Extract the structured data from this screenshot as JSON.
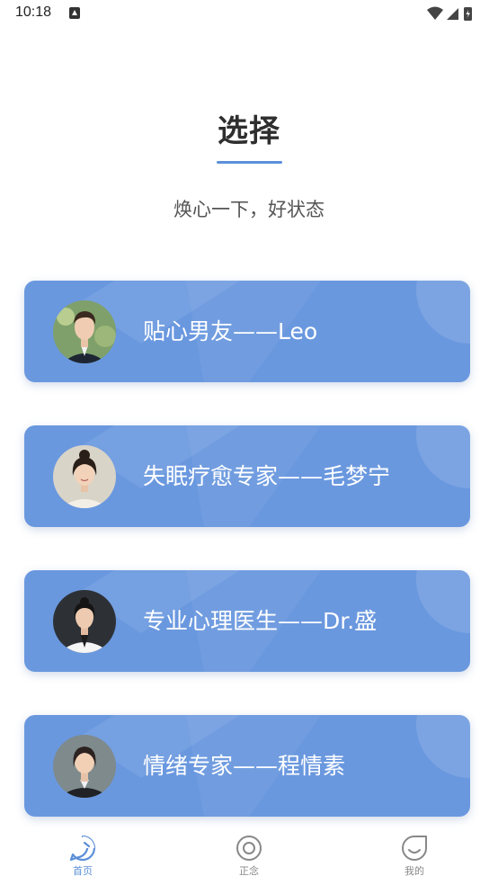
{
  "status_bar": {
    "time": "10:18"
  },
  "header": {
    "title": "选择",
    "subtitle": "焕心一下，好状态"
  },
  "cards": [
    {
      "label": "贴心男友——Leo"
    },
    {
      "label": "失眠疗愈专家——毛梦宁"
    },
    {
      "label": "专业心理医生——Dr.盛"
    },
    {
      "label": "情绪专家——程情素"
    }
  ],
  "tab_bar": {
    "items": [
      {
        "label": "首页",
        "icon": "chat-bubble-icon",
        "active": true
      },
      {
        "label": "正念",
        "icon": "circle-target-icon",
        "active": false
      },
      {
        "label": "我的",
        "icon": "smile-face-icon",
        "active": false
      }
    ]
  },
  "colors": {
    "accent": "#5b8fd8",
    "card": "#6a98df",
    "inactive": "#888888"
  }
}
